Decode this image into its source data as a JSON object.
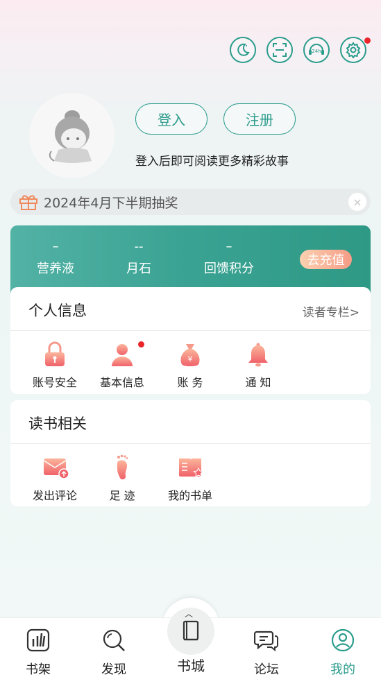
{
  "header": {
    "icons": [
      {
        "name": "night-mode-icon"
      },
      {
        "name": "scan-icon"
      },
      {
        "name": "customer-service-icon",
        "label": "24h"
      },
      {
        "name": "settings-icon",
        "has_badge": true
      }
    ]
  },
  "profile": {
    "login_label": "登入",
    "register_label": "注册",
    "hint": "登入后即可阅读更多精彩故事"
  },
  "lottery": {
    "text": "2024年4月下半期抽奖",
    "close_symbol": "×"
  },
  "wallet": {
    "stats": [
      {
        "value": "–",
        "label": "营养液"
      },
      {
        "value": "--",
        "label": "月石"
      },
      {
        "value": "–",
        "label": "回馈积分"
      }
    ],
    "recharge_label": "去充值"
  },
  "personal": {
    "title": "个人信息",
    "link": "读者专栏>",
    "items": [
      {
        "label": "账号安全",
        "icon": "lock-icon"
      },
      {
        "label": "基本信息",
        "icon": "user-icon",
        "has_badge": true
      },
      {
        "label": "账  务",
        "icon": "money-bag-icon"
      },
      {
        "label": "通  知",
        "icon": "bell-icon"
      }
    ]
  },
  "reading": {
    "title": "读书相关",
    "items": [
      {
        "label": "发出评论",
        "icon": "comment-mail-icon"
      },
      {
        "label": "足 迹",
        "icon": "footprint-icon"
      },
      {
        "label": "我的书单",
        "icon": "booklist-icon"
      }
    ]
  },
  "bottom_nav": {
    "items": [
      {
        "label": "书架",
        "icon": "bookshelf-icon"
      },
      {
        "label": "发现",
        "icon": "discover-icon"
      },
      {
        "label": "书城",
        "icon": "bookstore-icon"
      },
      {
        "label": "论坛",
        "icon": "forum-icon"
      },
      {
        "label": "我的",
        "icon": "profile-icon",
        "active": true
      }
    ],
    "active_color": "#2a9c8c"
  },
  "colors": {
    "accent": "#2a9c8c",
    "badge": "#e8262b",
    "icon_gradient_start": "#fbb59b",
    "icon_gradient_end": "#f0626a"
  }
}
